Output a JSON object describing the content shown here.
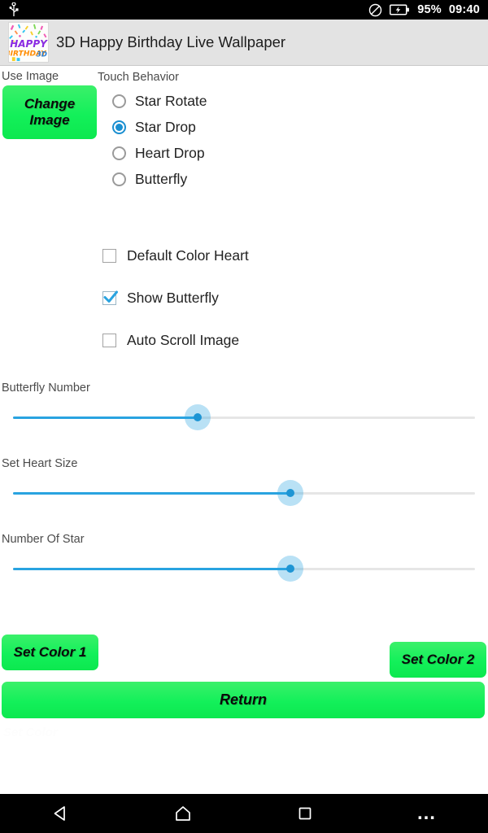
{
  "status_bar": {
    "usb_icon": "usb-icon",
    "block_icon": "do-not-disturb-icon",
    "battery_icon": "battery-charging-icon",
    "battery_percent": "95%",
    "clock": "09:40"
  },
  "app_bar": {
    "icon": "app-icon-happy-birthday",
    "title": "3D Happy Birthday Live Wallpaper",
    "icon_text": {
      "line1": "HAPPY",
      "line2": "BIRTHDAY",
      "line3": "3D"
    }
  },
  "use_image": {
    "label": "Use Image",
    "change_button": "Change\nImage"
  },
  "touch_behavior": {
    "label": "Touch Behavior",
    "selected": "Star Drop",
    "options": [
      {
        "label": "Star Rotate",
        "selected": false
      },
      {
        "label": "Star Drop",
        "selected": true
      },
      {
        "label": "Heart Drop",
        "selected": false
      },
      {
        "label": "Butterfly",
        "selected": false
      }
    ]
  },
  "checkboxes": [
    {
      "label": "Default Color Heart",
      "checked": false
    },
    {
      "label": "Show Butterfly",
      "checked": true
    },
    {
      "label": "Auto Scroll Image",
      "checked": false
    }
  ],
  "sliders": [
    {
      "label": "Butterfly Number",
      "percent": 40
    },
    {
      "label": "Set Heart Size",
      "percent": 60
    },
    {
      "label": "Number Of Star",
      "percent": 60
    }
  ],
  "bottom_buttons": {
    "set_color_1": "Set Color 1",
    "set_color_2": "Set Color 2",
    "return": "Return",
    "ghost": "Set Color"
  },
  "nav_bar": {
    "back": "back-icon",
    "home": "home-icon",
    "recents": "recents-icon",
    "overflow": "overflow-menu-icon"
  },
  "colors": {
    "accent_blue": "#29a3e0",
    "button_green": "#13f05a",
    "appbar_gray": "#e3e3e3",
    "bar_black": "#000000"
  }
}
